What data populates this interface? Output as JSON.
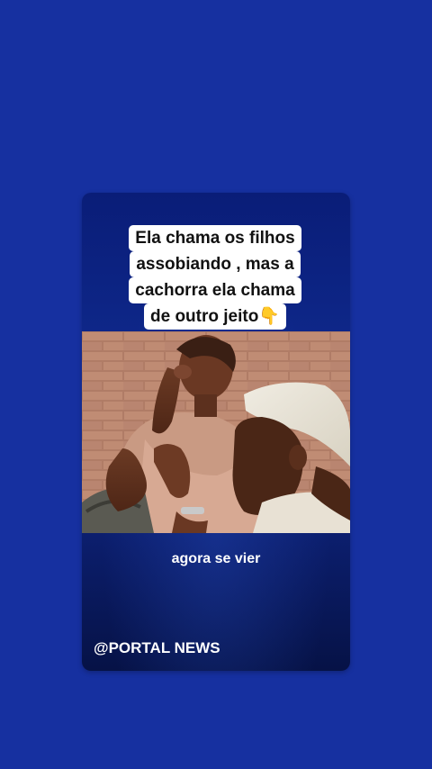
{
  "post": {
    "caption_lines": [
      "Ela chama os filhos",
      "assobiando , mas a",
      "cachorra ela chama",
      "de outro jeito👇"
    ],
    "subtitle": "agora se vier",
    "watermark": "@PORTAL NEWS"
  },
  "colors": {
    "background": "#1630a0",
    "card_top": "#0a1d78",
    "card_bottom": "#061246",
    "caption_bg": "#ffffff",
    "caption_text": "#111111"
  },
  "video": {
    "description_icon": "video-frame"
  }
}
